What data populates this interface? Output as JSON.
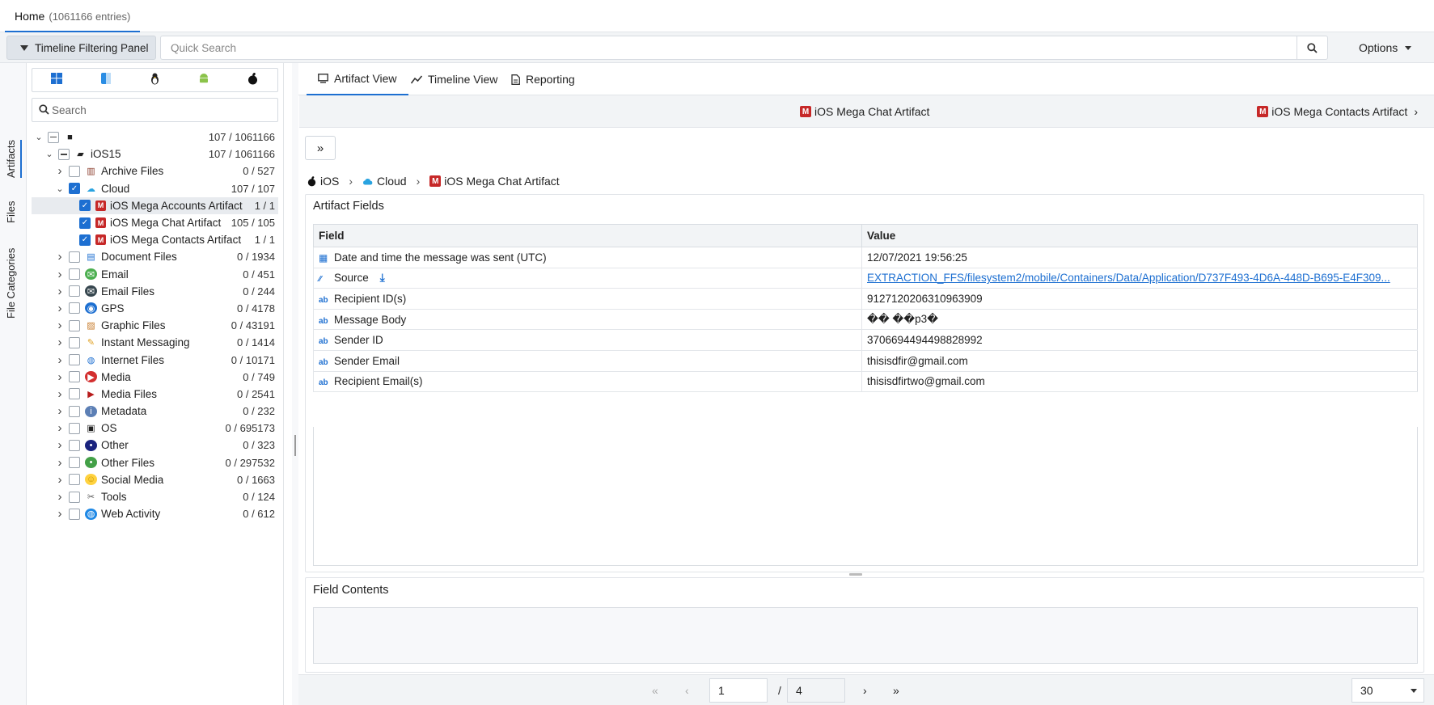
{
  "topbar": {
    "home_label": "Home",
    "home_count": "(1061166 entries)"
  },
  "toolbar": {
    "panel_button": "Timeline Filtering Panel",
    "quick_search_placeholder": "Quick Search",
    "options_label": "Options"
  },
  "rail": {
    "artifacts": "Artifacts",
    "files": "Files",
    "file_categories": "File Categories"
  },
  "left": {
    "search_placeholder": "Search",
    "os_icons": [
      "windows-icon",
      "mac-finder-icon",
      "linux-icon",
      "android-icon",
      "apple-icon"
    ],
    "tree": [
      {
        "indent": 0,
        "chev": "v",
        "check": "partial",
        "icon": "case-icon",
        "label": "",
        "count": "107 / 1061166"
      },
      {
        "indent": 1,
        "chev": "v",
        "check": "partial",
        "icon": "folder-icon",
        "label": "iOS15",
        "count": "107 / 1061166"
      },
      {
        "indent": 2,
        "chev": ">",
        "check": "none",
        "icon": "archive-icon",
        "label": "Archive Files",
        "count": "0 / 527"
      },
      {
        "indent": 2,
        "chev": "v",
        "check": "checked",
        "icon": "cloud-icon",
        "label": "Cloud",
        "count": "107 / 107"
      },
      {
        "indent": 3,
        "chev": "",
        "check": "checked",
        "icon": "mega-icon",
        "label": "iOS Mega Accounts Artifact",
        "count": "1 / 1",
        "selected": true
      },
      {
        "indent": 3,
        "chev": "",
        "check": "checked",
        "icon": "mega-icon",
        "label": "iOS Mega Chat Artifact",
        "count": "105 / 105"
      },
      {
        "indent": 3,
        "chev": "",
        "check": "checked",
        "icon": "mega-icon",
        "label": "iOS Mega Contacts Artifact",
        "count": "1 / 1"
      },
      {
        "indent": 2,
        "chev": ">",
        "check": "none",
        "icon": "document-icon",
        "label": "Document Files",
        "count": "0 / 1934"
      },
      {
        "indent": 2,
        "chev": ">",
        "check": "none",
        "icon": "email-icon",
        "label": "Email",
        "count": "0 / 451"
      },
      {
        "indent": 2,
        "chev": ">",
        "check": "none",
        "icon": "email-files-icon",
        "label": "Email Files",
        "count": "0 / 244"
      },
      {
        "indent": 2,
        "chev": ">",
        "check": "none",
        "icon": "gps-icon",
        "label": "GPS",
        "count": "0 / 4178"
      },
      {
        "indent": 2,
        "chev": ">",
        "check": "none",
        "icon": "graphic-icon",
        "label": "Graphic Files",
        "count": "0 / 43191"
      },
      {
        "indent": 2,
        "chev": ">",
        "check": "none",
        "icon": "chat-icon",
        "label": "Instant Messaging",
        "count": "0 / 1414"
      },
      {
        "indent": 2,
        "chev": ">",
        "check": "none",
        "icon": "globe-icon",
        "label": "Internet Files",
        "count": "0 / 10171"
      },
      {
        "indent": 2,
        "chev": ">",
        "check": "none",
        "icon": "media-icon",
        "label": "Media",
        "count": "0 / 749"
      },
      {
        "indent": 2,
        "chev": ">",
        "check": "none",
        "icon": "media-files-icon",
        "label": "Media Files",
        "count": "0 / 2541"
      },
      {
        "indent": 2,
        "chev": ">",
        "check": "none",
        "icon": "info-icon",
        "label": "Metadata",
        "count": "0 / 232"
      },
      {
        "indent": 2,
        "chev": ">",
        "check": "none",
        "icon": "os-icon",
        "label": "OS",
        "count": "0 / 695173"
      },
      {
        "indent": 2,
        "chev": ">",
        "check": "none",
        "icon": "other-icon",
        "label": "Other",
        "count": "0 / 323"
      },
      {
        "indent": 2,
        "chev": ">",
        "check": "none",
        "icon": "other-files-icon",
        "label": "Other Files",
        "count": "0 / 297532"
      },
      {
        "indent": 2,
        "chev": ">",
        "check": "none",
        "icon": "social-icon",
        "label": "Social Media",
        "count": "0 / 1663"
      },
      {
        "indent": 2,
        "chev": ">",
        "check": "none",
        "icon": "tools-icon",
        "label": "Tools",
        "count": "0 / 124"
      },
      {
        "indent": 2,
        "chev": ">",
        "check": "none",
        "icon": "web-icon",
        "label": "Web Activity",
        "count": "0 / 612"
      }
    ]
  },
  "tabs": [
    "Artifact View",
    "Timeline View",
    "Reporting"
  ],
  "subnav": {
    "current": "iOS Mega Chat Artifact",
    "next": "iOS Mega Contacts Artifact"
  },
  "breadcrumb": [
    "iOS",
    "Cloud",
    "iOS Mega Chat Artifact"
  ],
  "fields": {
    "title": "Artifact Fields",
    "col_field": "Field",
    "col_value": "Value",
    "rows": [
      {
        "icon": "calendar-icon",
        "field": "Date and time the message was sent (UTC)",
        "value": "12/07/2021 19:56:25",
        "link": false
      },
      {
        "icon": "source-icon",
        "field": "Source",
        "value": "EXTRACTION_FFS/filesystem2/mobile/Containers/Data/Application/D737F493-4D6A-448D-B695-E4F309...",
        "link": true
      },
      {
        "icon": "text-icon",
        "field": "Recipient ID(s)",
        "value": "9127120206310963909",
        "link": false
      },
      {
        "icon": "text-icon",
        "field": "Message Body",
        "value": "�� ��p3�",
        "link": false
      },
      {
        "icon": "text-icon",
        "field": "Sender ID",
        "value": "3706694494498828992",
        "link": false
      },
      {
        "icon": "text-icon",
        "field": "Sender Email",
        "value": "thisisdfir@gmail.com",
        "link": false
      },
      {
        "icon": "text-icon",
        "field": "Recipient Email(s)",
        "value": "thisisdfirtwo@gmail.com",
        "link": false
      }
    ]
  },
  "contents": {
    "title": "Field Contents"
  },
  "pager": {
    "page": "1",
    "sep": "/",
    "total": "4",
    "per_page": "30"
  },
  "colors": {
    "accent": "#1d6fd1",
    "mega": "#c62828"
  }
}
